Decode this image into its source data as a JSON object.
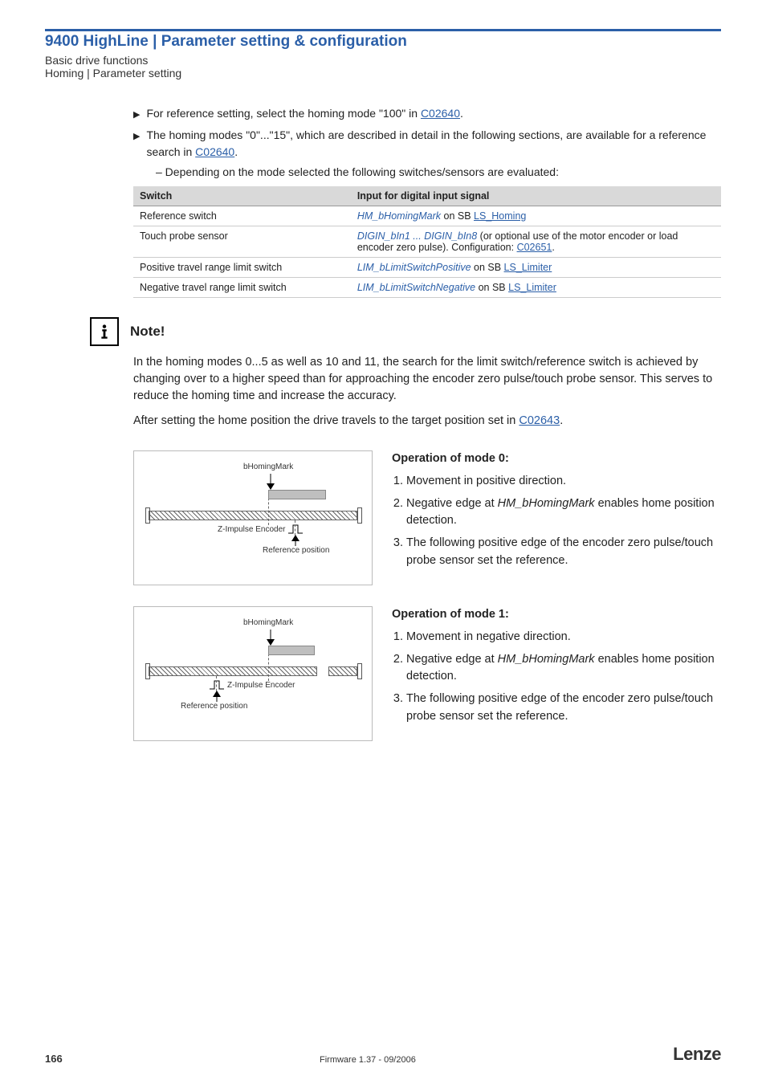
{
  "header": {
    "title": "9400 HighLine | Parameter setting & configuration",
    "sub1": "Basic drive functions",
    "sub2": "Homing | Parameter setting"
  },
  "bullets": {
    "b1a": "For reference setting, select the homing mode \"100\" in ",
    "b1link": "C02640",
    "b1b": ".",
    "b2a": "The homing modes \"0\"...\"15\", which are described in detail in the following sections, are available for a reference search in ",
    "b2link": "C02640",
    "b2b": ".",
    "sub": "– Depending on the mode selected the following switches/sensors are evaluated:"
  },
  "table": {
    "h1": "Switch",
    "h2": "Input for digital input signal",
    "rows": [
      {
        "switch": "Reference switch",
        "sigA": "HM_bHomingMark",
        "sigB": " on SB ",
        "sigLink": "LS_Homing"
      },
      {
        "switch": "Touch probe sensor",
        "sigA": "DIGIN_bIn1 ... DIGIN_bIn8",
        "sigB": " (or optional use of the motor encoder or load encoder zero pulse). Configuration: ",
        "sigLink": "C02651",
        "sigEnd": "."
      },
      {
        "switch": "Positive travel range limit switch",
        "sigA": "LIM_bLimitSwitchPositive",
        "sigB": " on SB ",
        "sigLink": "LS_Limiter"
      },
      {
        "switch": "Negative travel range limit switch",
        "sigA": "LIM_bLimitSwitchNegative",
        "sigB": " on SB ",
        "sigLink": "LS_Limiter"
      }
    ]
  },
  "note": {
    "label": "Note!",
    "p1": "In the homing modes 0...5 as well as 10 and 11, the search for the limit switch/reference switch is achieved by changing over to a higher speed than for approaching the encoder zero pulse/touch probe sensor. This serves to reduce the homing time and increase the accuracy.",
    "p2a": "After setting the home position the drive travels to the target position set in ",
    "p2link": "C02643",
    "p2b": "."
  },
  "diag": {
    "homingMark": "bHomingMark",
    "zimp": "Z-Impulse Encoder",
    "refpos": "Reference position"
  },
  "mode0": {
    "title": "Operation of mode 0:",
    "s1": "Movement in positive direction.",
    "s2a": "Negative edge at ",
    "s2i": "HM_bHomingMark",
    "s2b": " enables home position detection.",
    "s3": "The following positive edge of the encoder zero pulse/touch probe sensor set the reference."
  },
  "mode1": {
    "title": "Operation of mode 1:",
    "s1": "Movement in negative direction.",
    "s2a": "Negative edge at ",
    "s2i": "HM_bHomingMark",
    "s2b": " enables home position detection.",
    "s3": "The following positive edge of the encoder zero pulse/touch probe sensor set the reference."
  },
  "footer": {
    "page": "166",
    "center": "Firmware 1.37 - 09/2006",
    "logo": "Lenze"
  }
}
